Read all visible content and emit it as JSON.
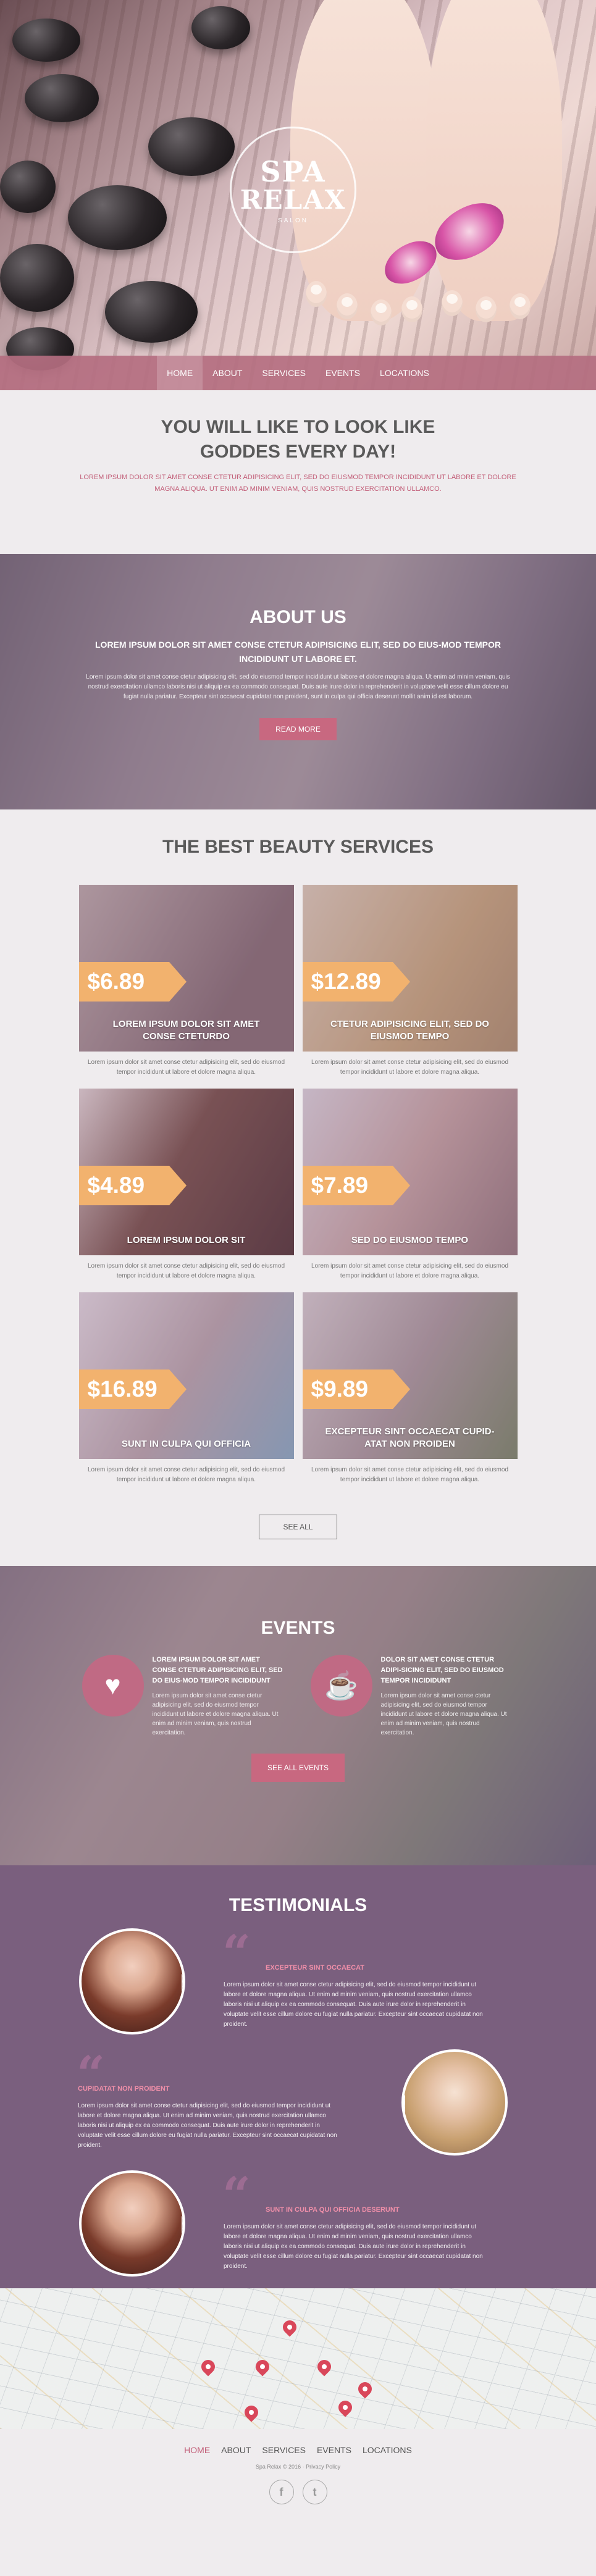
{
  "brand": {
    "line1": "SPA",
    "line2": "RELAX",
    "tagline": "SALON"
  },
  "nav": {
    "items": [
      "HOME",
      "ABOUT",
      "SERVICES",
      "EVENTS",
      "LOCATIONS"
    ],
    "active": "HOME"
  },
  "intro": {
    "heading_line1": "YOU WILL LIKE TO LOOK LIKE",
    "heading_line2": "GODDES EVERY DAY!",
    "text": "LOREM IPSUM DOLOR SIT AMET CONSE CTETUR ADIPISICING ELIT, SED DO EIUSMOD TEMPOR INCIDIDUNT UT LABORE ET DOLORE MAGNA ALIQUA. UT ENIM AD MINIM VENIAM, QUIS NOSTRUD EXERCITATION ULLAMCO."
  },
  "about": {
    "title": "ABOUT US",
    "lead": "LOREM IPSUM DOLOR SIT AMET CONSE CTETUR ADIPISICING ELIT, SED DO EIUS-MOD TEMPOR INCIDIDUNT UT LABORE ET.",
    "body": "Lorem ipsum dolor sit amet conse ctetur adipisicing elit, sed do eiusmod tempor incididunt ut labore et dolore magna aliqua. Ut enim ad minim veniam, quis nostrud exercitation ullamco laboris nisi ut aliquip ex ea commodo consequat. Duis aute irure dolor in reprehenderit in voluptate velit esse cillum dolore eu fugiat nulla pariatur. Excepteur sint occaecat cupidatat non proident, sunt in culpa qui officia deserunt mollit anim id est laborum.",
    "button": "READ MORE"
  },
  "services": {
    "title": "THE BEST BEAUTY SERVICES",
    "items": [
      {
        "price": "$6.89",
        "name": "LOREM IPSUM DOLOR SIT AMET CONSE CTETURDO",
        "desc": "Lorem ipsum dolor sit amet conse ctetur adipisicing elit, sed do eiusmod tempor incididunt ut labore et dolore magna aliqua."
      },
      {
        "price": "$12.89",
        "name": "CTETUR ADIPISICING ELIT, SED DO EIUSMOD TEMPO",
        "desc": "Lorem ipsum dolor sit amet conse ctetur adipisicing elit, sed do eiusmod tempor incididunt ut labore et dolore magna aliqua."
      },
      {
        "price": "$4.89",
        "name": "LOREM IPSUM DOLOR SIT",
        "desc": "Lorem ipsum dolor sit amet conse ctetur adipisicing elit, sed do eiusmod tempor incididunt ut labore et dolore magna aliqua."
      },
      {
        "price": "$7.89",
        "name": "SED DO EIUSMOD TEMPO",
        "desc": "Lorem ipsum dolor sit amet conse ctetur adipisicing elit, sed do eiusmod tempor incididunt ut labore et dolore magna aliqua."
      },
      {
        "price": "$16.89",
        "name": "SUNT IN CULPA QUI OFFICIA",
        "desc": "Lorem ipsum dolor sit amet conse ctetur adipisicing elit, sed do eiusmod tempor incididunt ut labore et dolore magna aliqua."
      },
      {
        "price": "$9.89",
        "name": "EXCEPTEUR SINT OCCAECAT CUPID-ATAT NON PROIDEN",
        "desc": "Lorem ipsum dolor sit amet conse ctetur adipisicing elit, sed do eiusmod tempor incididunt ut labore et dolore magna aliqua."
      }
    ],
    "button": "SEE ALL"
  },
  "events": {
    "title": "EVENTS",
    "items": [
      {
        "icon": "heart-icon",
        "title": "LOREM IPSUM DOLOR SIT AMET CONSE CTETUR ADIPISICING ELIT, SED DO EIUS-MOD TEMPOR INCIDIDUNT",
        "desc": "Lorem ipsum dolor sit amet conse ctetur adipisicing elit, sed do eiusmod tempor incididunt ut labore et dolore magna aliqua. Ut enim ad minim veniam, quis nostrud exercitation."
      },
      {
        "icon": "cup-icon",
        "title": "DOLOR SIT AMET CONSE CTETUR ADIPI-SICING ELIT, SED DO EIUSMOD TEMPOR INCIDIDUNT",
        "desc": "Lorem ipsum dolor sit amet conse ctetur adipisicing elit, sed do eiusmod tempor incididunt ut labore et dolore magna aliqua. Ut enim ad minim veniam, quis nostrud exercitation."
      }
    ],
    "button": "SEE ALL EVENTS"
  },
  "testimonials": {
    "title": "TESTIMONIALS",
    "items": [
      {
        "name": "EXCEPTEUR SINT OCCAECAT",
        "text": "Lorem ipsum dolor sit amet conse ctetur adipisicing elit, sed do eiusmod tempor incididunt ut labore et dolore magna aliqua. Ut enim ad minim veniam, quis nostrud exercitation ullamco laboris nisi ut aliquip ex ea commodo consequat. Duis aute irure dolor in reprehenderit in voluptate velit esse cillum dolore eu fugiat nulla pariatur. Excepteur sint occaecat cupidatat non proident."
      },
      {
        "name": "CUPIDATAT NON PROIDENT",
        "text": "Lorem ipsum dolor sit amet conse ctetur adipisicing elit, sed do eiusmod tempor incididunt ut labore et dolore magna aliqua. Ut enim ad minim veniam, quis nostrud exercitation ullamco laboris nisi ut aliquip ex ea commodo consequat. Duis aute irure dolor in reprehenderit in voluptate velit esse cillum dolore eu fugiat nulla pariatur. Excepteur sint occaecat cupidatat non proident."
      },
      {
        "name": "SUNT IN CULPA QUI OFFICIA DESERUNT",
        "text": "Lorem ipsum dolor sit amet conse ctetur adipisicing elit, sed do eiusmod tempor incididunt ut labore et dolore magna aliqua. Ut enim ad minim veniam, quis nostrud exercitation ullamco laboris nisi ut aliquip ex ea commodo consequat. Duis aute irure dolor in reprehenderit in voluptate velit esse cillum dolore eu fugiat nulla pariatur. Excepteur sint occaecat cupidatat non proident."
      }
    ]
  },
  "footer": {
    "nav": [
      "HOME",
      "ABOUT",
      "SERVICES",
      "EVENTS",
      "LOCATIONS"
    ],
    "active": "HOME",
    "copyright": "Spa Relax © 2016 · Privacy Policy",
    "social": [
      {
        "icon": "facebook-icon",
        "glyph": "f"
      },
      {
        "icon": "twitter-icon",
        "glyph": "t"
      }
    ]
  },
  "colors": {
    "accent": "#c86880",
    "price": "#f2b26e",
    "testimonials_bg": "#7a5f7e"
  }
}
